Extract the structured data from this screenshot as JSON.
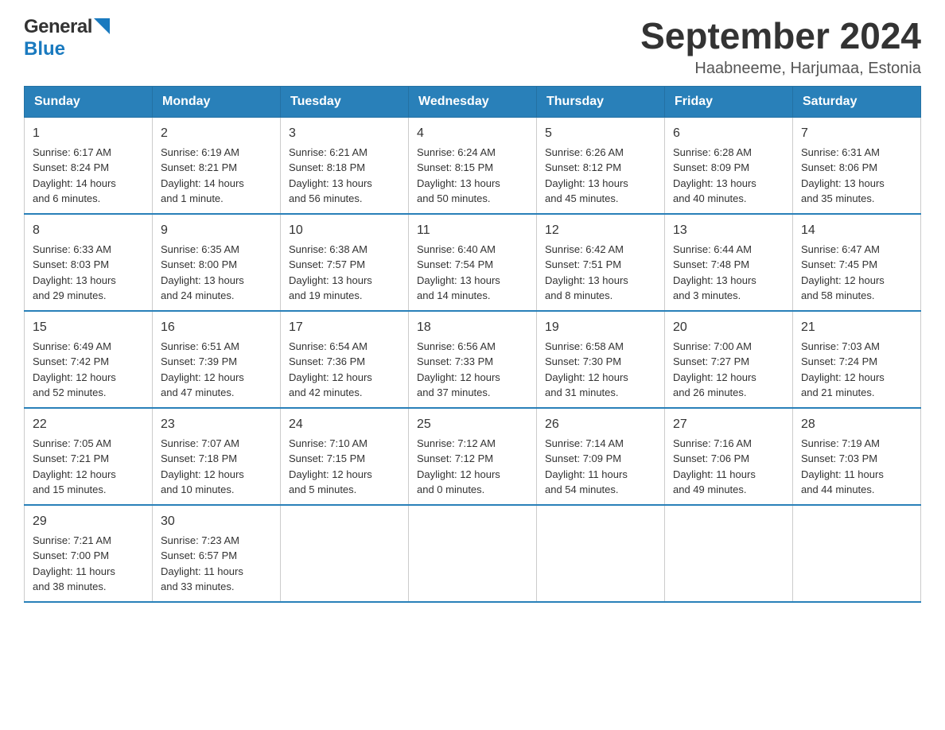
{
  "logo": {
    "text_general": "General",
    "text_blue": "Blue"
  },
  "header": {
    "month_year": "September 2024",
    "location": "Haabneeme, Harjumaa, Estonia"
  },
  "days_of_week": [
    "Sunday",
    "Monday",
    "Tuesday",
    "Wednesday",
    "Thursday",
    "Friday",
    "Saturday"
  ],
  "weeks": [
    [
      {
        "day": "1",
        "sunrise": "6:17 AM",
        "sunset": "8:24 PM",
        "daylight": "14 hours and 6 minutes."
      },
      {
        "day": "2",
        "sunrise": "6:19 AM",
        "sunset": "8:21 PM",
        "daylight": "14 hours and 1 minute."
      },
      {
        "day": "3",
        "sunrise": "6:21 AM",
        "sunset": "8:18 PM",
        "daylight": "13 hours and 56 minutes."
      },
      {
        "day": "4",
        "sunrise": "6:24 AM",
        "sunset": "8:15 PM",
        "daylight": "13 hours and 50 minutes."
      },
      {
        "day": "5",
        "sunrise": "6:26 AM",
        "sunset": "8:12 PM",
        "daylight": "13 hours and 45 minutes."
      },
      {
        "day": "6",
        "sunrise": "6:28 AM",
        "sunset": "8:09 PM",
        "daylight": "13 hours and 40 minutes."
      },
      {
        "day": "7",
        "sunrise": "6:31 AM",
        "sunset": "8:06 PM",
        "daylight": "13 hours and 35 minutes."
      }
    ],
    [
      {
        "day": "8",
        "sunrise": "6:33 AM",
        "sunset": "8:03 PM",
        "daylight": "13 hours and 29 minutes."
      },
      {
        "day": "9",
        "sunrise": "6:35 AM",
        "sunset": "8:00 PM",
        "daylight": "13 hours and 24 minutes."
      },
      {
        "day": "10",
        "sunrise": "6:38 AM",
        "sunset": "7:57 PM",
        "daylight": "13 hours and 19 minutes."
      },
      {
        "day": "11",
        "sunrise": "6:40 AM",
        "sunset": "7:54 PM",
        "daylight": "13 hours and 14 minutes."
      },
      {
        "day": "12",
        "sunrise": "6:42 AM",
        "sunset": "7:51 PM",
        "daylight": "13 hours and 8 minutes."
      },
      {
        "day": "13",
        "sunrise": "6:44 AM",
        "sunset": "7:48 PM",
        "daylight": "13 hours and 3 minutes."
      },
      {
        "day": "14",
        "sunrise": "6:47 AM",
        "sunset": "7:45 PM",
        "daylight": "12 hours and 58 minutes."
      }
    ],
    [
      {
        "day": "15",
        "sunrise": "6:49 AM",
        "sunset": "7:42 PM",
        "daylight": "12 hours and 52 minutes."
      },
      {
        "day": "16",
        "sunrise": "6:51 AM",
        "sunset": "7:39 PM",
        "daylight": "12 hours and 47 minutes."
      },
      {
        "day": "17",
        "sunrise": "6:54 AM",
        "sunset": "7:36 PM",
        "daylight": "12 hours and 42 minutes."
      },
      {
        "day": "18",
        "sunrise": "6:56 AM",
        "sunset": "7:33 PM",
        "daylight": "12 hours and 37 minutes."
      },
      {
        "day": "19",
        "sunrise": "6:58 AM",
        "sunset": "7:30 PM",
        "daylight": "12 hours and 31 minutes."
      },
      {
        "day": "20",
        "sunrise": "7:00 AM",
        "sunset": "7:27 PM",
        "daylight": "12 hours and 26 minutes."
      },
      {
        "day": "21",
        "sunrise": "7:03 AM",
        "sunset": "7:24 PM",
        "daylight": "12 hours and 21 minutes."
      }
    ],
    [
      {
        "day": "22",
        "sunrise": "7:05 AM",
        "sunset": "7:21 PM",
        "daylight": "12 hours and 15 minutes."
      },
      {
        "day": "23",
        "sunrise": "7:07 AM",
        "sunset": "7:18 PM",
        "daylight": "12 hours and 10 minutes."
      },
      {
        "day": "24",
        "sunrise": "7:10 AM",
        "sunset": "7:15 PM",
        "daylight": "12 hours and 5 minutes."
      },
      {
        "day": "25",
        "sunrise": "7:12 AM",
        "sunset": "7:12 PM",
        "daylight": "12 hours and 0 minutes."
      },
      {
        "day": "26",
        "sunrise": "7:14 AM",
        "sunset": "7:09 PM",
        "daylight": "11 hours and 54 minutes."
      },
      {
        "day": "27",
        "sunrise": "7:16 AM",
        "sunset": "7:06 PM",
        "daylight": "11 hours and 49 minutes."
      },
      {
        "day": "28",
        "sunrise": "7:19 AM",
        "sunset": "7:03 PM",
        "daylight": "11 hours and 44 minutes."
      }
    ],
    [
      {
        "day": "29",
        "sunrise": "7:21 AM",
        "sunset": "7:00 PM",
        "daylight": "11 hours and 38 minutes."
      },
      {
        "day": "30",
        "sunrise": "7:23 AM",
        "sunset": "6:57 PM",
        "daylight": "11 hours and 33 minutes."
      },
      null,
      null,
      null,
      null,
      null
    ]
  ],
  "labels": {
    "sunrise": "Sunrise:",
    "sunset": "Sunset:",
    "daylight": "Daylight:"
  }
}
